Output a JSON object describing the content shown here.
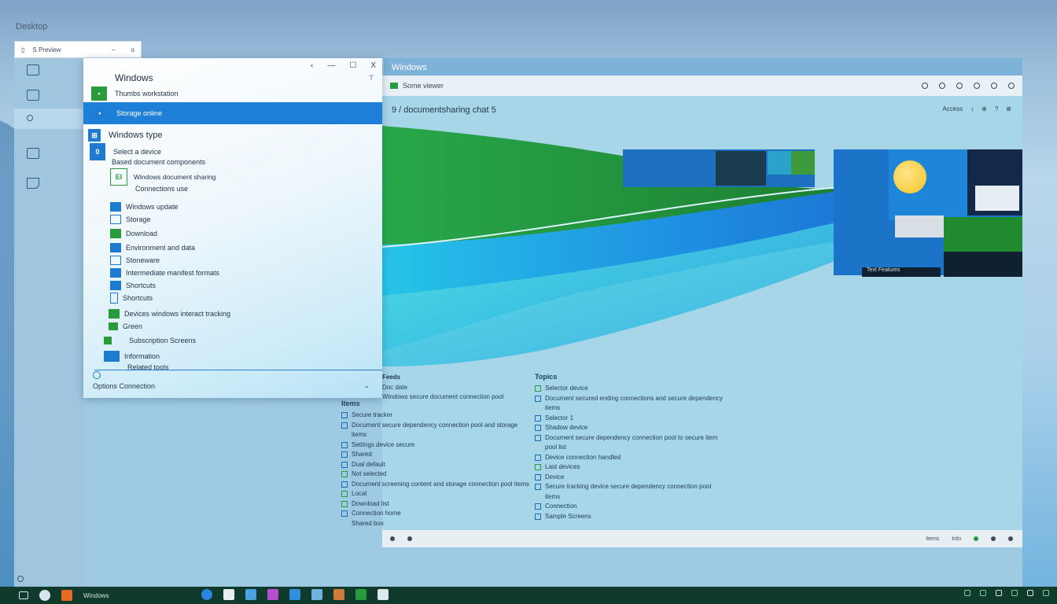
{
  "desktop": {
    "title": "Desktop"
  },
  "small_window": {
    "title": "S Preview",
    "ctrl": "–",
    "close": "o"
  },
  "back_window": {
    "title": "Windows"
  },
  "nav_window": {
    "title": "Windows",
    "controls": [
      "‹",
      "—",
      "☐",
      "X"
    ],
    "pin": "⊤",
    "rows": [
      {
        "label": "Thumbs workstation",
        "icon": "green-tile-icon"
      },
      {
        "label": "Storage online",
        "icon": "blue-tile-icon",
        "selected": true
      },
      {
        "label": "Windows type",
        "icon": "windows-icon"
      },
      {
        "label": "Select a device",
        "icon": "device-icon"
      },
      {
        "label": "Based document components",
        "icon": ""
      },
      {
        "label": "Windows document sharing",
        "icon": "sharing-icon"
      },
      {
        "label": "Connections use",
        "icon": ""
      },
      {
        "label": "Windows update",
        "icon": "update-icon"
      },
      {
        "label": "Storage",
        "icon": "storage-icon"
      },
      {
        "label": "Download",
        "icon": "download-icon"
      },
      {
        "label": "Environment and data",
        "icon": "environment-icon"
      },
      {
        "label": "Stoneware",
        "icon": "stoneware-icon"
      },
      {
        "label": "Intermediate manifest formats",
        "icon": "manifest-icon"
      },
      {
        "label": "Shortcuts",
        "icon": "shortcuts-icon"
      },
      {
        "label": "Shortcuts",
        "icon": "shortcuts2-icon"
      },
      {
        "label": "Devices windows interact tracking",
        "icon": "tracking-icon"
      },
      {
        "label": "Green",
        "icon": "green-icon"
      },
      {
        "label": "Subscription Screens",
        "icon": "subscription-icon"
      },
      {
        "label": "Information",
        "icon": "info-icon"
      },
      {
        "label": "Related tools",
        "icon": ""
      }
    ],
    "footer": "Options Connection",
    "footer_chevron": "⌄"
  },
  "main_window": {
    "toolbar_title": "Some viewer",
    "subheading": "9 / documentsharing chat 5",
    "subright": [
      "Access",
      "↕",
      "⊕",
      "?",
      "⊗"
    ],
    "tile_caption": "Text Features",
    "status_right": [
      "Items",
      "Info"
    ],
    "lists": {
      "left_header_top": "Feeds",
      "left_header_top_line": "Doc date",
      "left_header_top_long": "Windows secure document connection pool",
      "left_header": "Items",
      "left_items": [
        "Secure tracker",
        "Document secure dependency connection pool and storage items",
        "Settings device secure",
        "Shared",
        "Dual default",
        "Not selected",
        "Document screening content and storage connection pool items",
        "Local",
        "Download list",
        "Connection home",
        "Shared box"
      ],
      "right_header": "Topics",
      "right_items": [
        "Selector device",
        "Document secured ending connections and secure dependency items",
        "Selector 1",
        "Shadow device",
        "Document secure dependency connection pool to secure item pool list",
        "Device connection handled",
        "Last devices",
        "Device",
        "Secure tracking device secure dependency connection pool items",
        "Connection",
        "Sample Screens"
      ]
    }
  },
  "taskbar": {
    "pinned_label": "Windows",
    "apps": [
      "edge-icon",
      "store-icon",
      "settings-icon",
      "photos-icon",
      "explorer-icon",
      "mail-icon",
      "folder-icon",
      "excel-icon",
      "calendar-icon"
    ]
  },
  "colors": {
    "accent": "#1e7fd8",
    "green": "#2a9b3c",
    "taskbar": "#103a2c"
  }
}
